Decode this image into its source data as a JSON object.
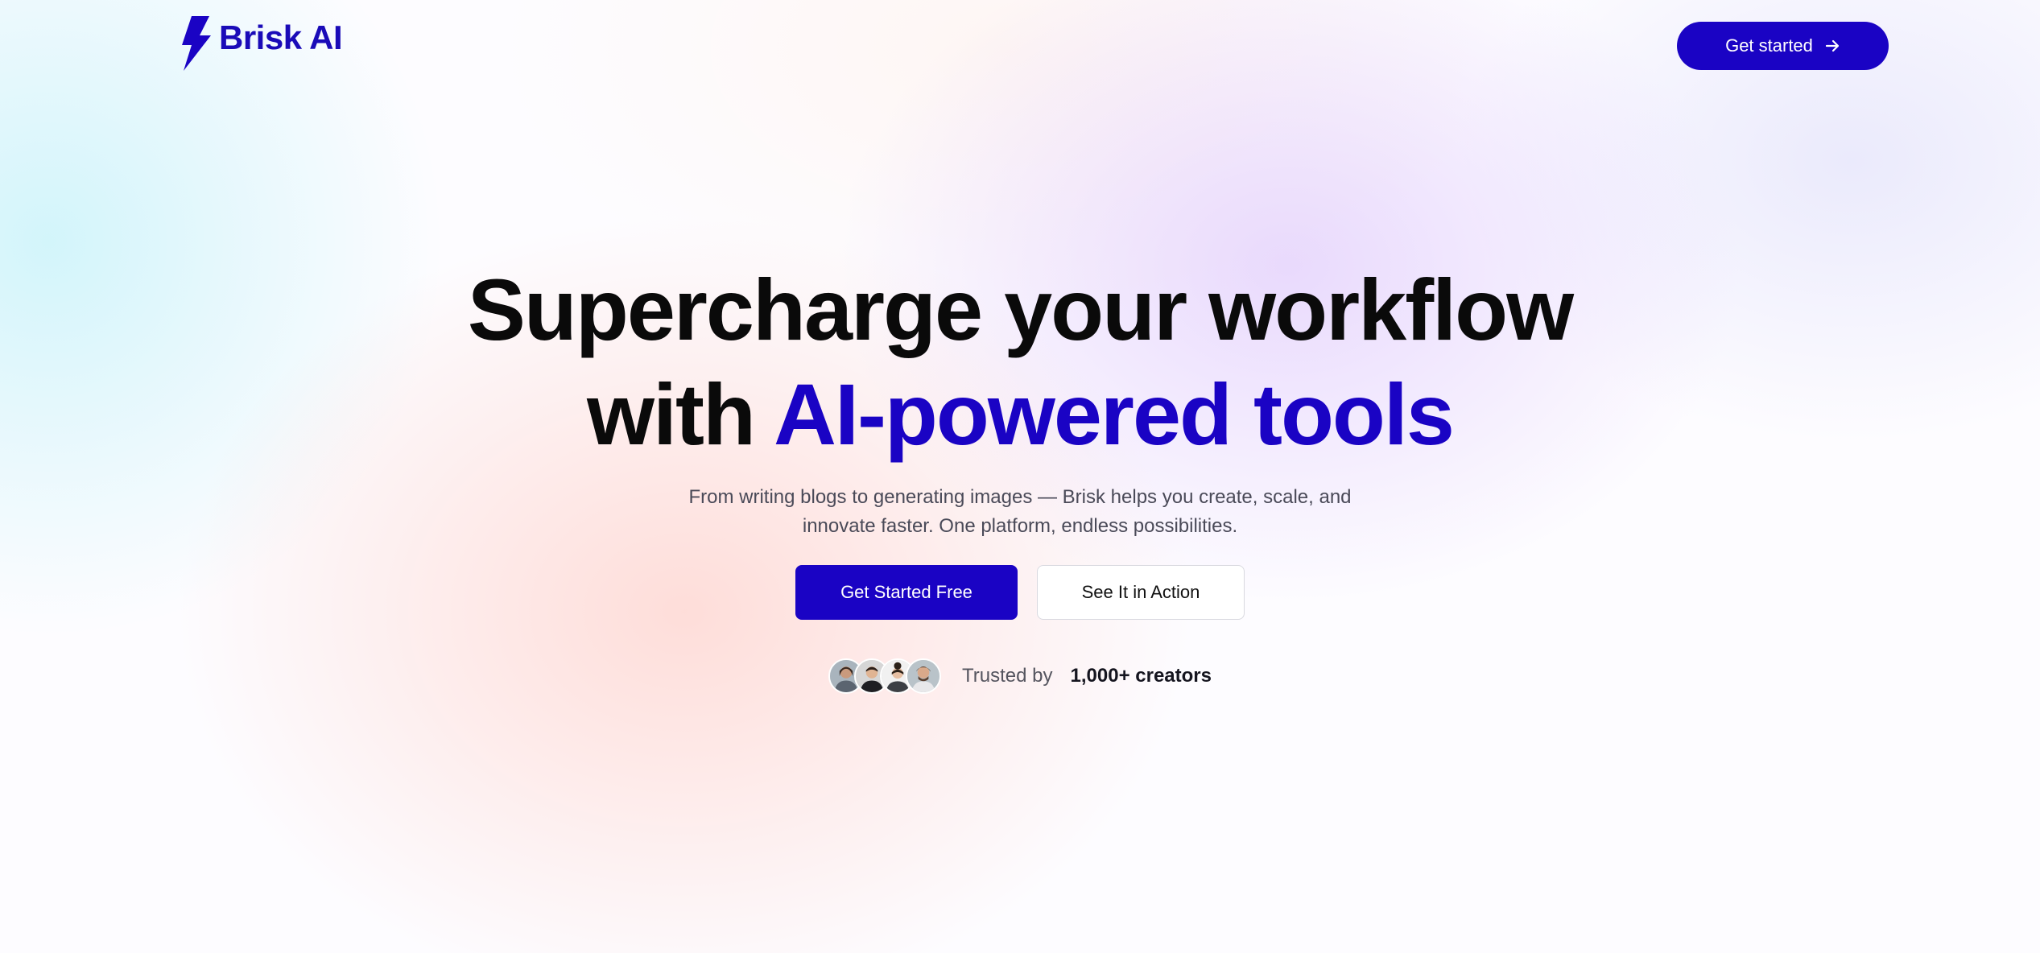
{
  "brand": {
    "name": "Brisk AI",
    "logo_icon": "lightning-bolt-icon",
    "primary_color": "#1a03c4"
  },
  "nav": {
    "cta_label": "Get started",
    "cta_icon": "arrow-right-icon"
  },
  "hero": {
    "headline_line1": "Supercharge your workflow",
    "headline_line2_prefix": "with ",
    "headline_line2_accent": "AI-powered tools",
    "subtitle": "From writing blogs to generating images — Brisk helps you create, scale, and innovate faster. One platform, endless possibilities.",
    "primary_button": "Get Started Free",
    "secondary_button": "See It in Action"
  },
  "social_proof": {
    "label": "Trusted by",
    "count": "1,000+ creators",
    "avatars": [
      "avatar-1",
      "avatar-2",
      "avatar-3",
      "avatar-4"
    ]
  }
}
